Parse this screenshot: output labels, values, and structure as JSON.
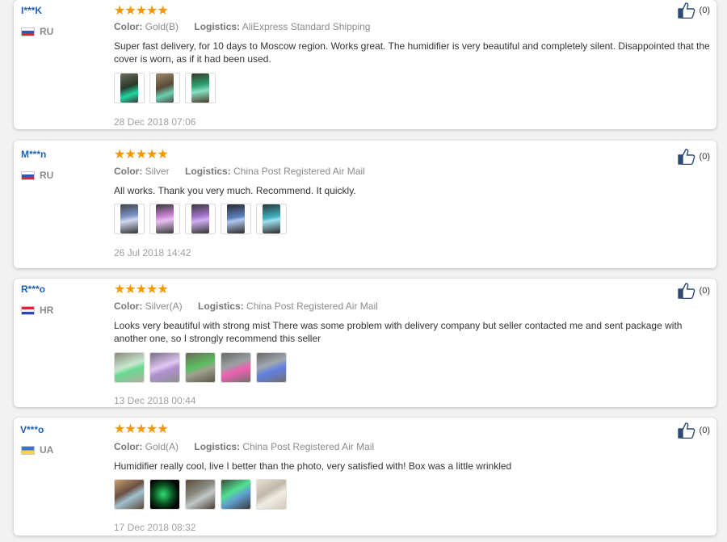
{
  "reviews": [
    {
      "user": "I***K",
      "country": "RU",
      "stars": "★★★★★",
      "color_label": "Color:",
      "color_value": "Gold(B)",
      "logistics_label": "Logistics:",
      "logistics_value": "AliExpress Standard Shipping",
      "text": "Super fast delivery, for 10 days to Moscow region. Works great. The humidifier is very beautiful and completely silent. Disappointed that the cover is worn, as if it had been used.",
      "date": "28 Dec 2018 07:06",
      "likes": "(0)"
    },
    {
      "user": "M***n",
      "country": "RU",
      "stars": "★★★★★",
      "color_label": "Color:",
      "color_value": "Silver",
      "logistics_label": "Logistics:",
      "logistics_value": "China Post Registered Air Mail",
      "text": "All works. Thank you very much. Recommend. It quickly.",
      "date": "26 Jul 2018 14:42",
      "likes": "(0)"
    },
    {
      "user": "R***o",
      "country": "HR",
      "stars": "★★★★★",
      "color_label": "Color:",
      "color_value": "Silver(A)",
      "logistics_label": "Logistics:",
      "logistics_value": "China Post Registered Air Mail",
      "text": "Looks very beautiful with strong mist There was some problem with delivery company but seller contacted me and sent package with another one, so I strongly recommend this seller",
      "date": "13 Dec 2018 00:44",
      "likes": "(0)"
    },
    {
      "user": "V***o",
      "country": "UA",
      "stars": "★★★★★",
      "color_label": "Color:",
      "color_value": "Gold(A)",
      "logistics_label": "Logistics:",
      "logistics_value": "China Post Registered Air Mail",
      "text": "Humidifier really cool, live I better than the photo, very satisfied with! Box was a little wrinkled",
      "date": "17 Dec 2018 08:32",
      "likes": "(0)"
    }
  ],
  "colors": {
    "star": "#f39800",
    "username": "#1f61b0"
  },
  "icons": {
    "like": "thumbs-up-icon"
  }
}
